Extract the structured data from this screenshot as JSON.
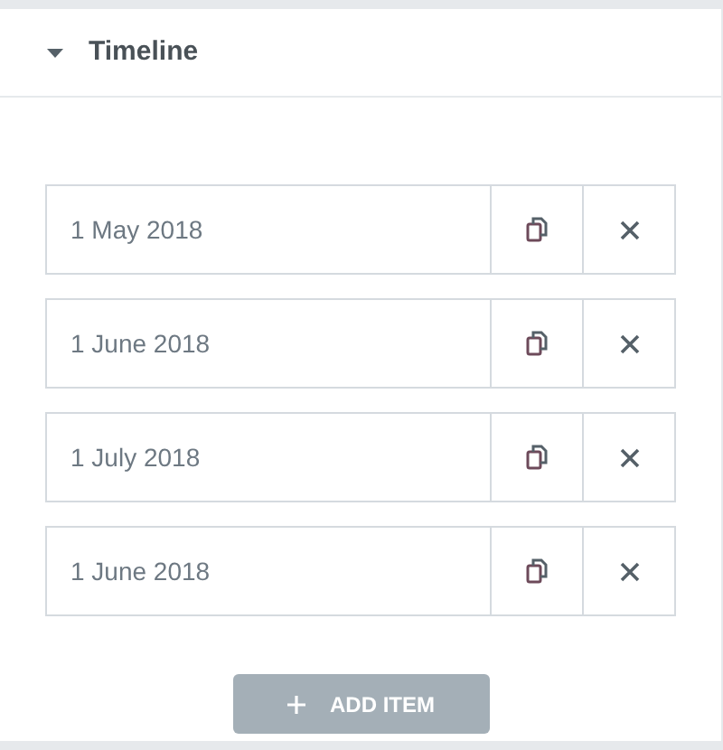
{
  "section": {
    "title": "Timeline",
    "expanded": true
  },
  "items": [
    {
      "label": "1 May 2018"
    },
    {
      "label": "1 June 2018"
    },
    {
      "label": "1 July 2018"
    },
    {
      "label": "1 June 2018"
    }
  ],
  "add_button": {
    "label": "ADD ITEM"
  }
}
